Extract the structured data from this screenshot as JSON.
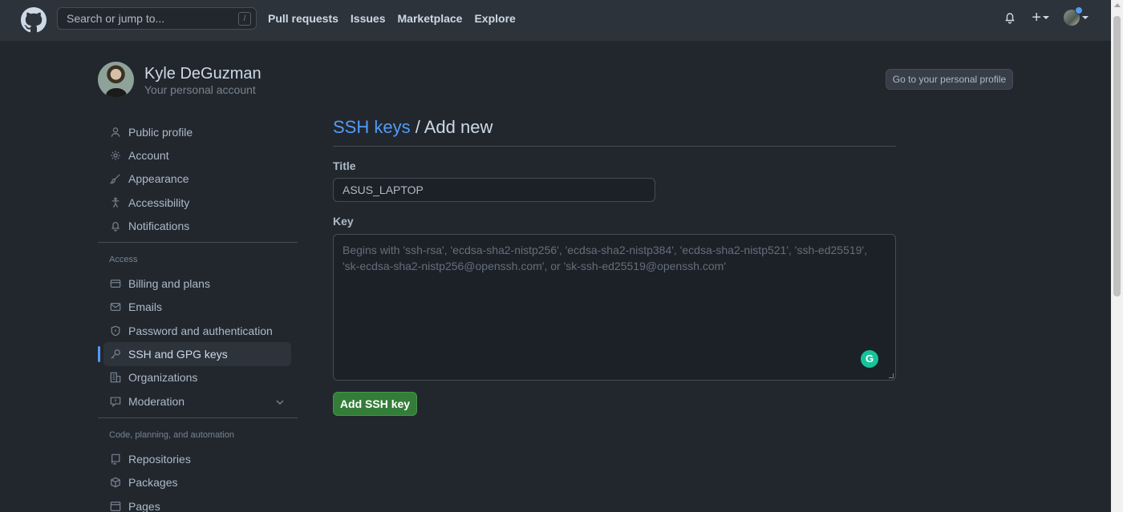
{
  "header": {
    "search_placeholder": "Search or jump to...",
    "search_shortcut": "/",
    "nav": [
      "Pull requests",
      "Issues",
      "Marketplace",
      "Explore"
    ],
    "plus": "+"
  },
  "profile": {
    "name": "Kyle DeGuzman",
    "subtitle": "Your personal account",
    "goto_button": "Go to your personal profile"
  },
  "sidebar": {
    "group1": [
      {
        "label": "Public profile",
        "icon": "person-icon"
      },
      {
        "label": "Account",
        "icon": "gear-icon"
      },
      {
        "label": "Appearance",
        "icon": "paintbrush-icon"
      },
      {
        "label": "Accessibility",
        "icon": "accessibility-icon"
      },
      {
        "label": "Notifications",
        "icon": "bell-icon"
      }
    ],
    "access_label": "Access",
    "group2": [
      {
        "label": "Billing and plans",
        "icon": "credit-card-icon"
      },
      {
        "label": "Emails",
        "icon": "mail-icon"
      },
      {
        "label": "Password and authentication",
        "icon": "shield-lock-icon"
      },
      {
        "label": "SSH and GPG keys",
        "icon": "key-icon",
        "active": true
      },
      {
        "label": "Organizations",
        "icon": "organization-icon"
      },
      {
        "label": "Moderation",
        "icon": "report-icon"
      }
    ],
    "code_label": "Code, planning, and automation",
    "group3": [
      {
        "label": "Repositories",
        "icon": "repo-icon"
      },
      {
        "label": "Packages",
        "icon": "package-icon"
      },
      {
        "label": "Pages",
        "icon": "browser-icon"
      }
    ]
  },
  "main": {
    "title_link": "SSH keys",
    "title_rest": " / Add new",
    "title_label": "Title",
    "title_value": "ASUS_LAPTOP",
    "key_label": "Key",
    "key_placeholder": "Begins with 'ssh-rsa', 'ecdsa-sha2-nistp256', 'ecdsa-sha2-nistp384', 'ecdsa-sha2-nistp521', 'ssh-ed25519', 'sk-ecdsa-sha2-nistp256@openssh.com', or 'sk-ssh-ed25519@openssh.com'",
    "grammarly_glyph": "G",
    "add_button": "Add SSH key"
  },
  "colors": {
    "background": "#22272e",
    "header": "#2d333b",
    "link": "#539bf5",
    "primary_button": "#347d39"
  }
}
